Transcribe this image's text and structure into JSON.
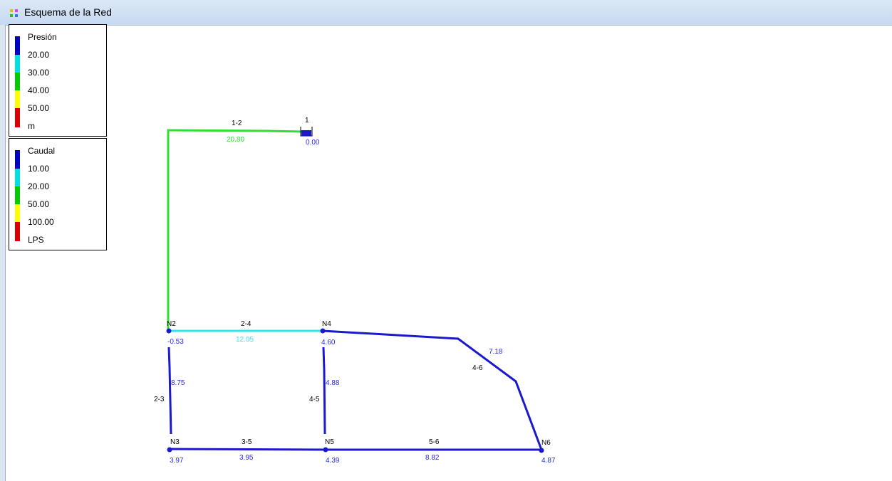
{
  "window": {
    "title": "Esquema de la Red"
  },
  "legend_pressure": {
    "title": "Presión",
    "labels": [
      "20.00",
      "30.00",
      "40.00",
      "50.00"
    ],
    "unit": "m",
    "colors": [
      "#0000cc",
      "#00e0e0",
      "#00cc00",
      "#ffff00",
      "#dd0000"
    ]
  },
  "legend_flow": {
    "title": "Caudal",
    "labels": [
      "10.00",
      "20.00",
      "50.00",
      "100.00"
    ],
    "unit": "LPS",
    "colors": [
      "#0000cc",
      "#00e0e0",
      "#00cc00",
      "#ffff00",
      "#dd0000"
    ]
  },
  "colors": {
    "green": "#33dd33",
    "cyan": "#33e6e6",
    "blue": "#1a1acc",
    "label_blue": "#2a2aee",
    "label_black": "#000000"
  },
  "nodes": [
    {
      "id": "1",
      "value": "0.00"
    },
    {
      "id": "N2",
      "value": "-0.53"
    },
    {
      "id": "N3",
      "value": "3.97"
    },
    {
      "id": "N4",
      "value": "4.60"
    },
    {
      "id": "N5",
      "value": "4.39"
    },
    {
      "id": "N6",
      "value": "4.87"
    }
  ],
  "pipes": [
    {
      "id": "1-2",
      "flow": "20.80",
      "color_class": "green"
    },
    {
      "id": "2-4",
      "flow": "12.05",
      "color_class": "cyan"
    },
    {
      "id": "2-3",
      "flow": "8.75",
      "color_class": "blue"
    },
    {
      "id": "4-5",
      "flow": "4.88",
      "color_class": "blue"
    },
    {
      "id": "4-6",
      "flow": "7.18",
      "color_class": "blue"
    },
    {
      "id": "3-5",
      "flow": "3.95",
      "color_class": "blue"
    },
    {
      "id": "5-6",
      "flow": "8.82",
      "color_class": "blue"
    }
  ]
}
